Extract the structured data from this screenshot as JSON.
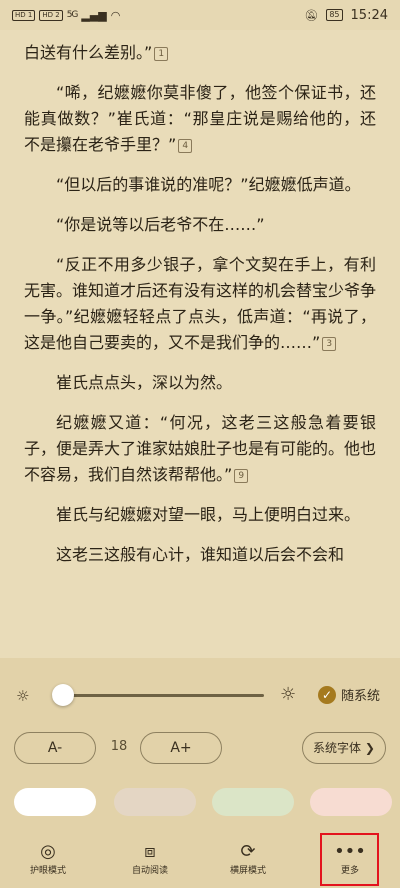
{
  "status_bar": {
    "sim1": "HD 1",
    "sim2": "HD 2",
    "signal": "5G",
    "battery": "85",
    "time": "15:24"
  },
  "reader": {
    "paragraphs": [
      {
        "text": "白送有什么差别。”",
        "fn": "1"
      },
      {
        "text": "“唏，纪嬷嬷你莫非傻了，他签个保证书，还能真做数？”崔氏道：“那皇庄说是赐给他的，还不是攥在老爷手里？”",
        "fn": "4"
      },
      {
        "text": "“但以后的事谁说的准呢？”纪嬷嬷低声道。",
        "fn": ""
      },
      {
        "text": "“你是说等以后老爷不在……”",
        "fn": ""
      },
      {
        "text": "“反正不用多少银子，拿个文契在手上，有利无害。谁知道才后还有没有这样的机会替宝少爷争一争。”纪嬷嬷轻轻点了点头，低声道：“再说了，这是他自己要卖的，又不是我们争的……”",
        "fn": "3"
      },
      {
        "text": "崔氏点点头，深以为然。",
        "fn": ""
      },
      {
        "text": "纪嬷嬷又道：“何况，这老三这般急着要银子，便是弄大了谁家姑娘肚子也是有可能的。他也不容易，我们自然该帮帮他。”",
        "fn": "9"
      },
      {
        "text": "崔氏与纪嬷嬷对望一眼，马上便明白过来。",
        "fn": ""
      },
      {
        "text": "这老三这般有心计，谁知道以后会不会和",
        "fn": ""
      }
    ]
  },
  "settings": {
    "follow_system_label": "随系统",
    "font_minus_label": "A-",
    "font_plus_label": "A+",
    "font_size": "18",
    "font_family_label": "系统字体",
    "brightness_level": 0.03
  },
  "toolbar": {
    "eye_care": "护眼模式",
    "auto_read": "自动阅读",
    "landscape": "横屏模式",
    "more": "更多"
  },
  "colors": {
    "accent": "#a57a1f",
    "highlight": "#e3131d",
    "page_bg": "#e9dcb9"
  }
}
